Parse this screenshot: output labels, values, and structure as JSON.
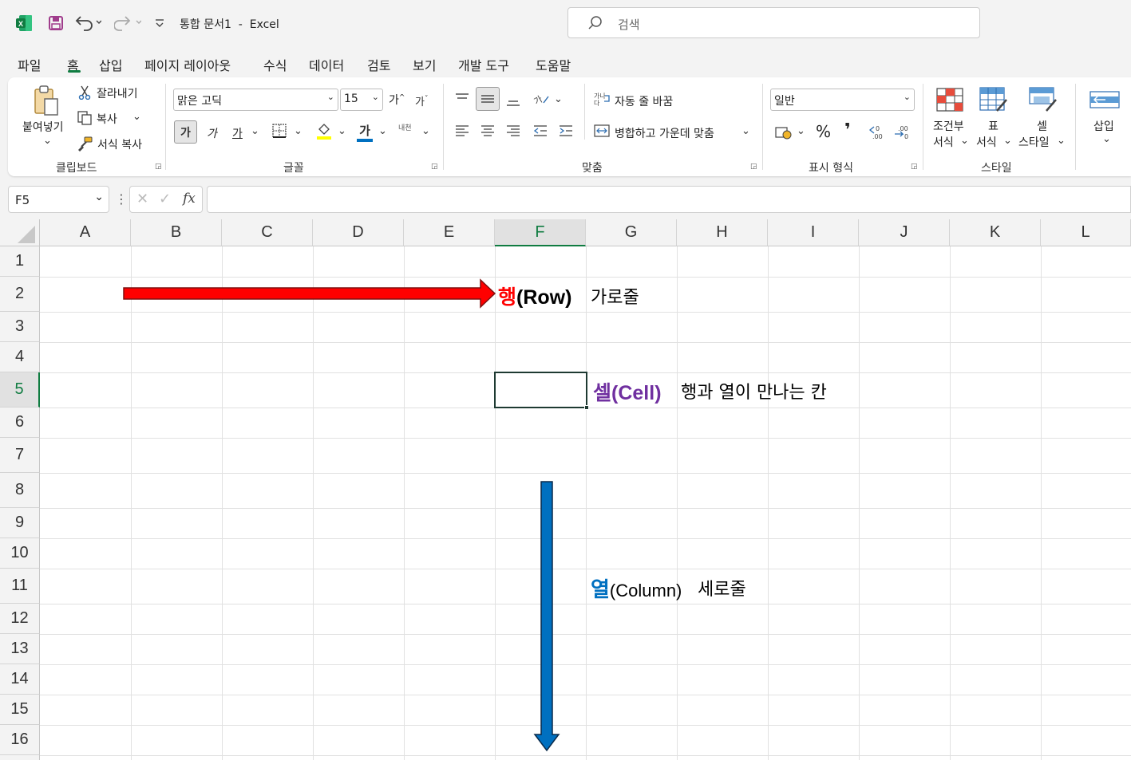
{
  "title_bar": {
    "document_title": "통합 문서1  -  Excel",
    "search_placeholder": "검색",
    "icons": [
      "excel-logo-icon",
      "save-icon",
      "undo-icon",
      "redo-icon",
      "customize-qat-icon",
      "search-icon"
    ]
  },
  "menu": {
    "tabs": [
      "파일",
      "홈",
      "삽입",
      "페이지 레이아웃",
      "수식",
      "데이터",
      "검토",
      "보기",
      "개발 도구",
      "도움말"
    ],
    "active_tab": "홈"
  },
  "ribbon": {
    "clipboard": {
      "paste_label": "붙여넣기",
      "cut_label": "잘라내기",
      "copy_label": "복사",
      "format_painter_label": "서식 복사",
      "group_label": "클립보드"
    },
    "font": {
      "font_name": "맑은 고딕",
      "font_size": "15",
      "increase_size": "가",
      "decrease_size": "가",
      "bold": "가",
      "italic": "가",
      "underline": "가",
      "font_color": "가",
      "phonetic": "내천",
      "group_label": "글꼴"
    },
    "alignment": {
      "wrap_text_label": "자동 줄 바꿈",
      "merge_center_label": "병합하고 가운데 맞춤",
      "group_label": "맞춤"
    },
    "number": {
      "format": "일반",
      "percent": "%",
      "comma": "❜",
      "group_label": "표시 형식"
    },
    "styles": {
      "conditional_format_line1": "조건부",
      "conditional_format_line2": "서식",
      "table_format_line1": "표",
      "table_format_line2": "서식",
      "cell_styles_line1": "셀",
      "cell_styles_line2": "스타일",
      "group_label": "스타일"
    },
    "cells": {
      "insert_label": "삽입"
    }
  },
  "formula_bar": {
    "name_box": "F5",
    "fx": "fx",
    "formula": ""
  },
  "sheet": {
    "columns": [
      "A",
      "B",
      "C",
      "D",
      "E",
      "F",
      "G",
      "H",
      "I",
      "J",
      "K",
      "L"
    ],
    "rows": [
      "1",
      "2",
      "3",
      "4",
      "5",
      "6",
      "7",
      "8",
      "9",
      "10",
      "11",
      "12",
      "13",
      "14",
      "15",
      "16"
    ],
    "selected_column": "F",
    "selected_row": "5",
    "accent_color": "#107c41"
  },
  "annotations": {
    "row": {
      "keyword": "행",
      "english": "(Row)",
      "desc": "가로줄",
      "keyword_color": "#ff0000",
      "arrow_color": "#ff0000"
    },
    "cell": {
      "keyword": "셀",
      "english": "(Cell)",
      "desc": "행과 열이 만나는 칸",
      "keyword_color": "#7030a0"
    },
    "column": {
      "keyword": "열",
      "english": "(Column)",
      "desc": "세로줄",
      "keyword_color": "#0070c0",
      "arrow_color": "#0070c0"
    }
  }
}
